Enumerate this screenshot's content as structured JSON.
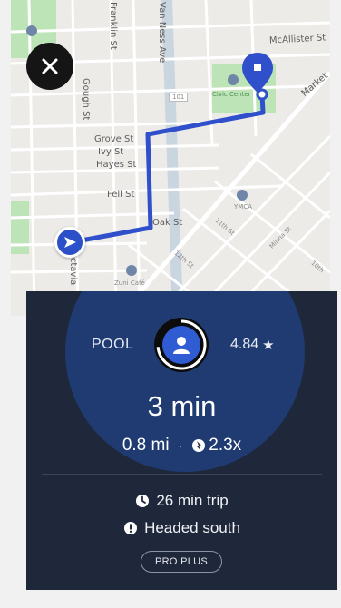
{
  "map": {
    "streets": {
      "franklin": "Franklin St",
      "van_ness": "Van Ness Ave",
      "mcallister": "McAllister St",
      "gough": "Gough St",
      "grove": "Grove St",
      "ivy": "Ivy St",
      "hayes": "Hayes St",
      "fell": "Fell St",
      "oak": "Oak St",
      "eleventh": "11th St",
      "twelfth": "12th St",
      "minna": "Minna St",
      "tenth": "10th",
      "octavia": "Octavia",
      "market": "Market",
      "highway": "101"
    },
    "places": {
      "park": "Civic Center",
      "cafe": "Zuni Café",
      "ymca": "YMCA"
    }
  },
  "close_button": {
    "icon": "close-icon"
  },
  "trip_card": {
    "product": "POOL",
    "rating": "4.84",
    "rating_icon": "star-icon",
    "eta": "3 min",
    "distance": "0.8 mi",
    "separator": "·",
    "surge": "2.3x",
    "trip_duration": "26 min trip",
    "direction": "Headed south",
    "badge": "PRO PLUS",
    "colors": {
      "card_bg": "#1f283a",
      "glow": "#1f3b72",
      "route": "#2f4fcb",
      "avatar": "#2f5bd3"
    }
  }
}
